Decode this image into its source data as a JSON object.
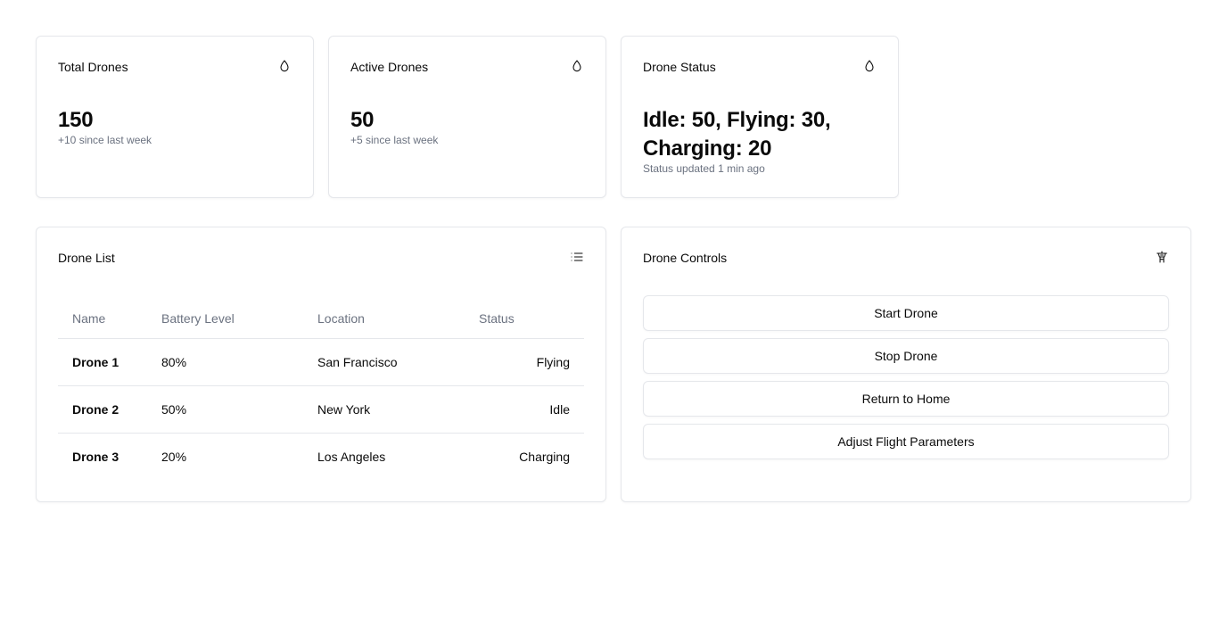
{
  "stats": {
    "total": {
      "title": "Total Drones",
      "value": "150",
      "sub": "+10 since last week",
      "icon": "droplet-icon"
    },
    "active": {
      "title": "Active Drones",
      "value": "50",
      "sub": "+5 since last week",
      "icon": "droplet-icon"
    },
    "status": {
      "title": "Drone Status",
      "value": "Idle: 50, Flying: 30, Charging: 20",
      "sub": "Status updated 1 min ago",
      "icon": "droplet-icon"
    }
  },
  "drone_list": {
    "title": "Drone List",
    "icon": "list-icon",
    "columns": [
      "Name",
      "Battery Level",
      "Location",
      "Status"
    ],
    "rows": [
      {
        "name": "Drone 1",
        "battery": "80%",
        "location": "San Francisco",
        "status": "Flying"
      },
      {
        "name": "Drone 2",
        "battery": "50%",
        "location": "New York",
        "status": "Idle"
      },
      {
        "name": "Drone 3",
        "battery": "20%",
        "location": "Los Angeles",
        "status": "Charging"
      }
    ]
  },
  "controls": {
    "title": "Drone Controls",
    "icon": "control-tower-icon",
    "buttons": [
      "Start Drone",
      "Stop Drone",
      "Return to Home",
      "Adjust Flight Parameters"
    ]
  },
  "colors": {
    "border": "#e5e7eb",
    "muted_text": "#6b7280",
    "text": "#0a0a0a"
  }
}
